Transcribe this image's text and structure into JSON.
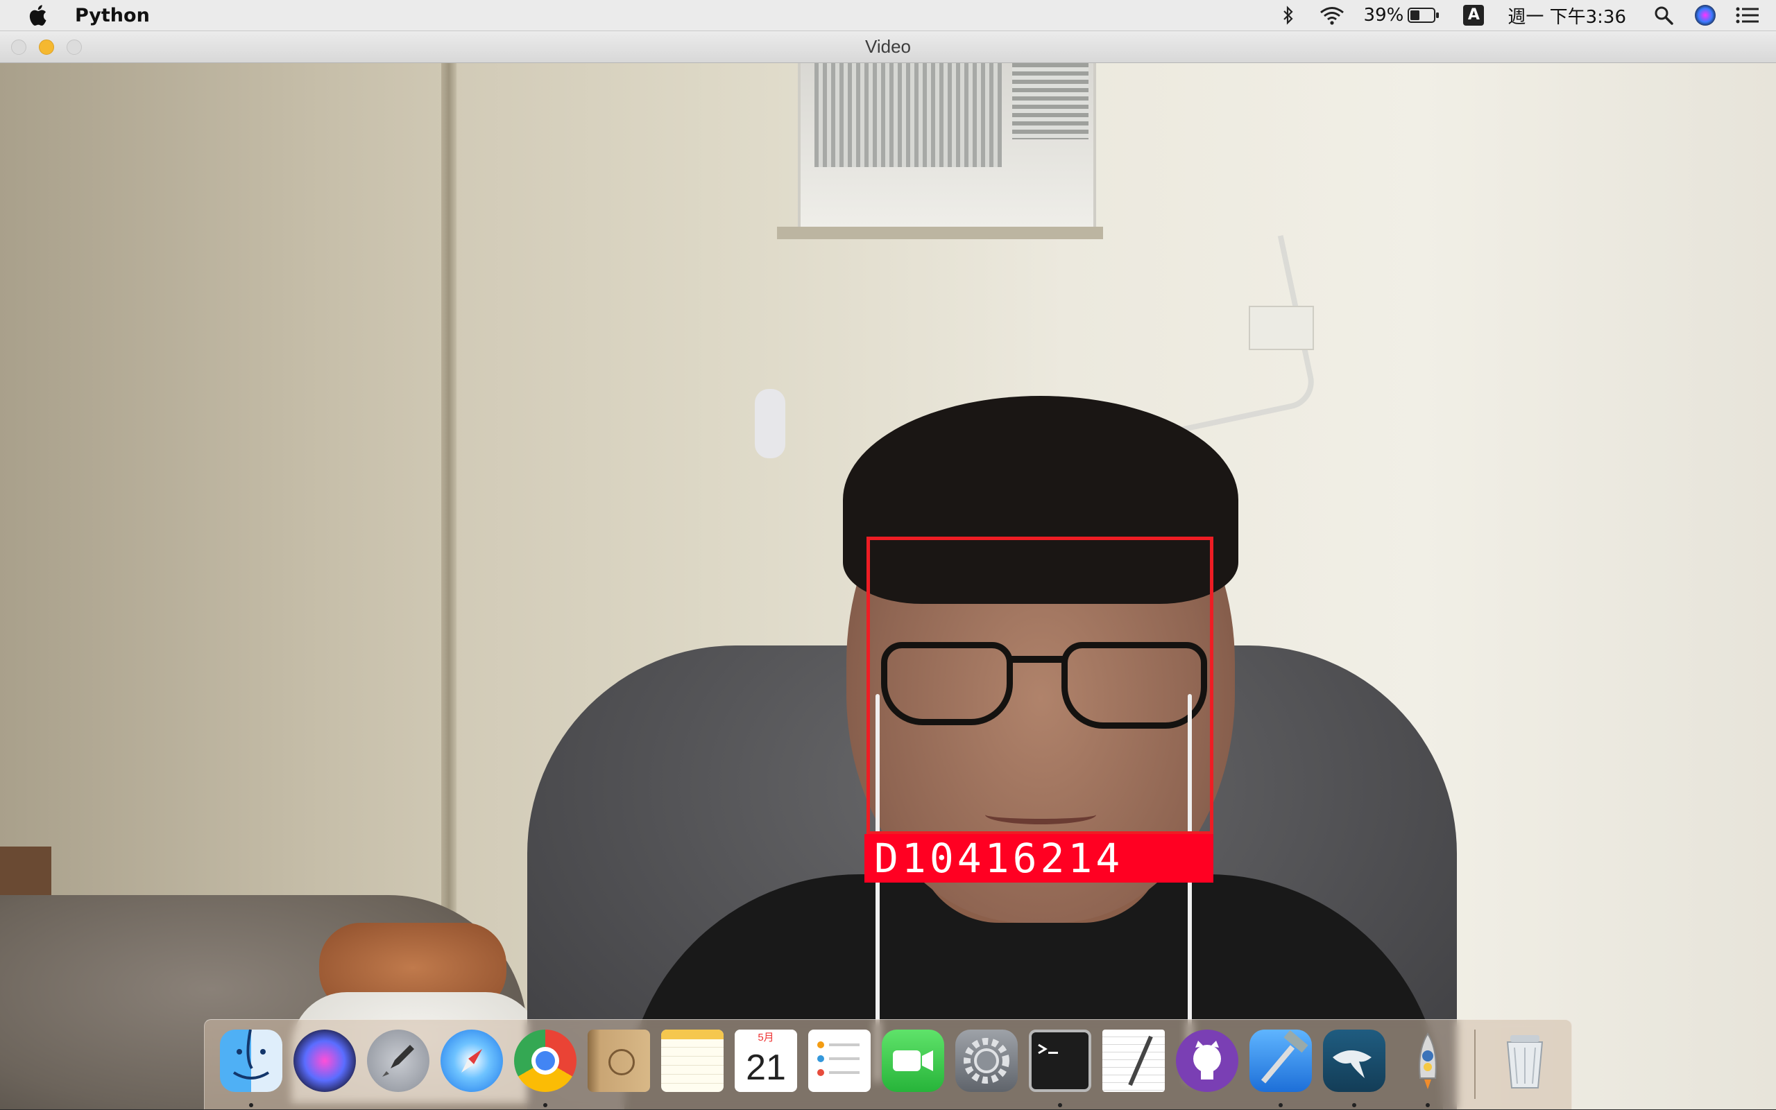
{
  "menubar": {
    "app_name": "Python",
    "battery_percent": "39%",
    "input_source": "A",
    "clock": "週一 下午3:36"
  },
  "window": {
    "title": "Video"
  },
  "detection": {
    "label": "D10416214",
    "box_color": "#ee1d24",
    "label_bg_color": "#ff0022"
  },
  "dock": {
    "items": [
      {
        "name": "finder",
        "icon": "finder-icon",
        "running": true
      },
      {
        "name": "siri",
        "icon": "siri-icon",
        "running": false
      },
      {
        "name": "launchpad",
        "icon": "rocket-icon",
        "running": false
      },
      {
        "name": "safari",
        "icon": "compass-icon",
        "running": false
      },
      {
        "name": "chrome",
        "icon": "chrome-icon",
        "running": true
      },
      {
        "name": "contacts",
        "icon": "contacts-book-icon",
        "running": false
      },
      {
        "name": "notes",
        "icon": "notes-icon",
        "running": false
      },
      {
        "name": "calendar",
        "icon": "calendar-icon",
        "running": false,
        "month": "5月",
        "day": "21"
      },
      {
        "name": "reminders",
        "icon": "reminders-icon",
        "running": false
      },
      {
        "name": "facetime",
        "icon": "video-camera-icon",
        "running": false
      },
      {
        "name": "system-preferences",
        "icon": "gear-icon",
        "running": false
      },
      {
        "name": "terminal",
        "icon": "terminal-icon",
        "running": true
      },
      {
        "name": "textedit",
        "icon": "document-pen-icon",
        "running": false
      },
      {
        "name": "github-desktop",
        "icon": "github-icon",
        "running": false
      },
      {
        "name": "xcode",
        "icon": "hammer-icon",
        "running": true
      },
      {
        "name": "mysql-workbench",
        "icon": "dolphin-icon",
        "running": true
      },
      {
        "name": "python-launcher",
        "icon": "python-rocket-icon",
        "running": true
      },
      {
        "name": "trash",
        "icon": "trash-icon",
        "running": false
      }
    ]
  }
}
